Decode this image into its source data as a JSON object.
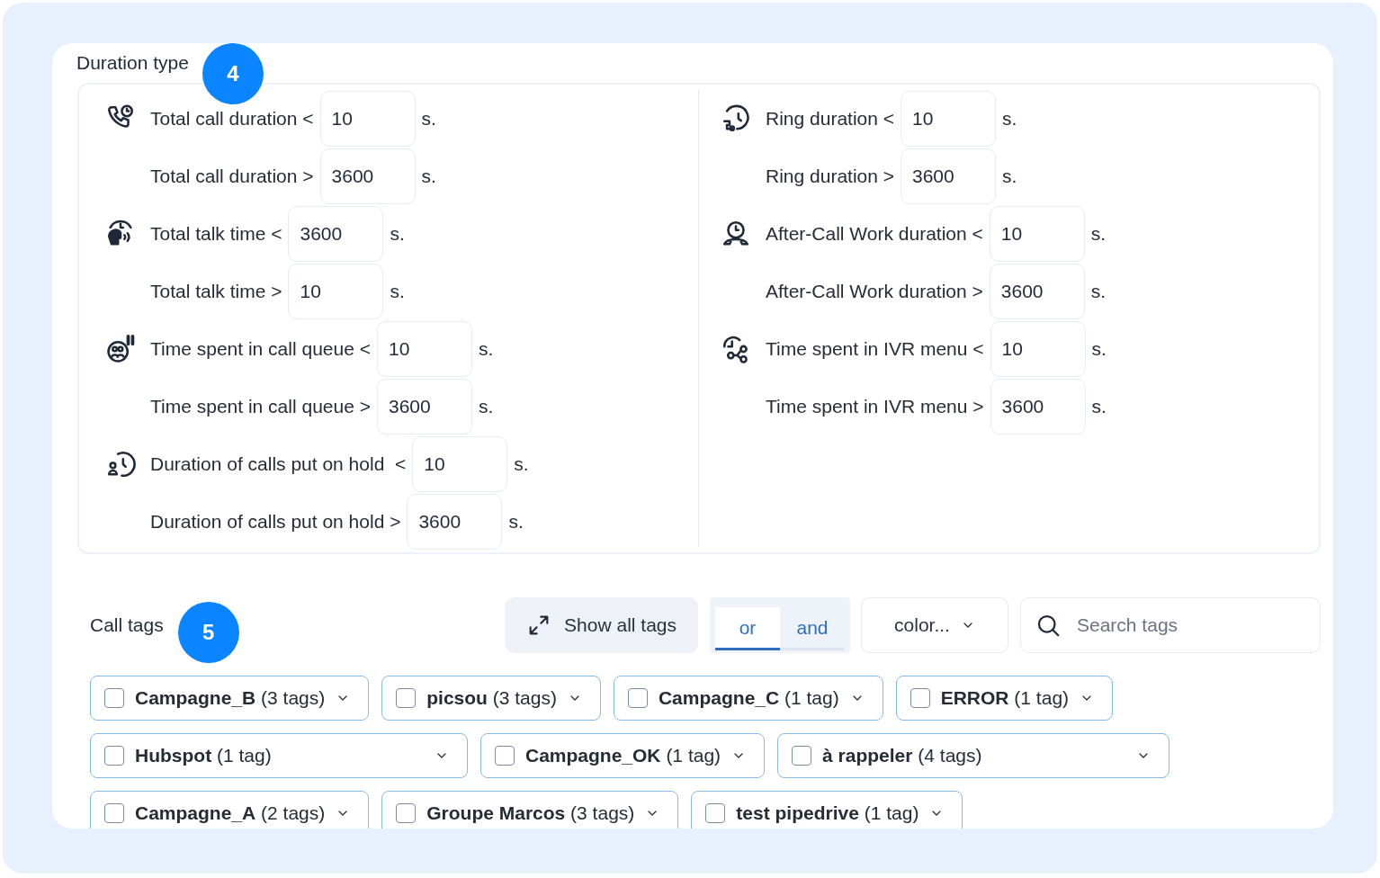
{
  "duration_type": {
    "title": "Duration type",
    "step": "4",
    "columns": [
      [
        {
          "rows": [
            {
              "label": "Total call duration <",
              "value": "10",
              "unit": "s."
            },
            {
              "label": "Total call duration >",
              "value": "3600",
              "unit": "s."
            }
          ]
        },
        {
          "rows": [
            {
              "label": "Total talk time <",
              "value": "3600",
              "unit": "s."
            },
            {
              "label": "Total talk time >",
              "value": "10",
              "unit": "s."
            }
          ]
        },
        {
          "rows": [
            {
              "label": "Time spent in call queue <",
              "value": "10",
              "unit": "s."
            },
            {
              "label": "Time spent in call queue >",
              "value": "3600",
              "unit": "s."
            }
          ]
        },
        {
          "rows": [
            {
              "label": "Duration of calls put on hold  <",
              "value": "10",
              "unit": "s."
            },
            {
              "label": "Duration of calls put on hold >",
              "value": "3600",
              "unit": "s."
            }
          ]
        }
      ],
      [
        {
          "rows": [
            {
              "label": "Ring duration <",
              "value": "10",
              "unit": "s."
            },
            {
              "label": "Ring duration >",
              "value": "3600",
              "unit": "s."
            }
          ]
        },
        {
          "rows": [
            {
              "label": "After-Call Work duration <",
              "value": "10",
              "unit": "s."
            },
            {
              "label": "After-Call Work duration >",
              "value": "3600",
              "unit": "s."
            }
          ]
        },
        {
          "rows": [
            {
              "label": "Time spent in IVR menu <",
              "value": "10",
              "unit": "s."
            },
            {
              "label": "Time spent in IVR menu >",
              "value": "3600",
              "unit": "s."
            }
          ]
        }
      ]
    ]
  },
  "call_tags": {
    "title": "Call tags",
    "step": "5",
    "show_all": "Show all tags",
    "logic": [
      {
        "label": "or",
        "selected": true
      },
      {
        "label": "and",
        "selected": false
      }
    ],
    "color_select": "color...",
    "search": {
      "placeholder": "Search tags"
    },
    "tag_rows": [
      [
        {
          "label": "**Campagne_B** (3 tags)",
          "checked": false
        },
        {
          "label": "**picsou** (3 tags)",
          "checked": false
        },
        {
          "label": "**Campagne_C** (1 tag)",
          "checked": false
        },
        {
          "label": "**ERROR** (1 tag)",
          "checked": false
        }
      ],
      [
        {
          "label": "**Hubspot** (1 tag)",
          "checked": false
        },
        {
          "label": "**Campagne_OK** (1 tag)",
          "checked": false
        },
        {
          "label": "**à rappeler** (4 tags)",
          "checked": false
        }
      ],
      [
        {
          "label": "**Campagne_A** (2 tags)",
          "checked": false
        },
        {
          "label": "**Groupe Marcos** (3 tags)",
          "checked": false
        },
        {
          "label": "**test pipedrive** (1 tag)",
          "checked": false
        }
      ]
    ]
  }
}
